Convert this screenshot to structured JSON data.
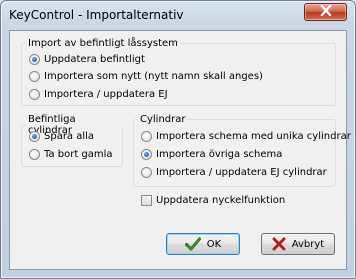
{
  "window": {
    "title": "KeyControl - Importalternativ",
    "close_icon": "close-icon"
  },
  "import_group": {
    "legend": "Import av befintligt låssystem",
    "options": [
      {
        "label": "Uppdatera befintligt",
        "selected": true
      },
      {
        "label": "Importera som nytt (nytt namn skall anges)",
        "selected": false
      },
      {
        "label": "Importera / uppdatera EJ",
        "selected": false
      }
    ]
  },
  "cylinders_existing_group": {
    "legend": "Befintliga cylindrar",
    "options": [
      {
        "label": "Spara alla",
        "selected": true
      },
      {
        "label": "Ta bort gamla",
        "selected": false
      }
    ]
  },
  "cylinders_group": {
    "legend": "Cylindrar",
    "options": [
      {
        "label": "Importera schema med unika cylindrar",
        "selected": false
      },
      {
        "label": "Importera övriga schema",
        "selected": true
      },
      {
        "label": "Importera / uppdatera EJ cylindrar",
        "selected": false
      }
    ]
  },
  "update_key_function": {
    "label": "Uppdatera nyckelfunktion",
    "checked": false
  },
  "buttons": {
    "ok_label": "OK",
    "ok_icon": "checkmark-icon",
    "ok_color": "#2f8a1f",
    "cancel_label": "Avbryt",
    "cancel_icon": "x-icon",
    "cancel_color": "#b0201a"
  }
}
